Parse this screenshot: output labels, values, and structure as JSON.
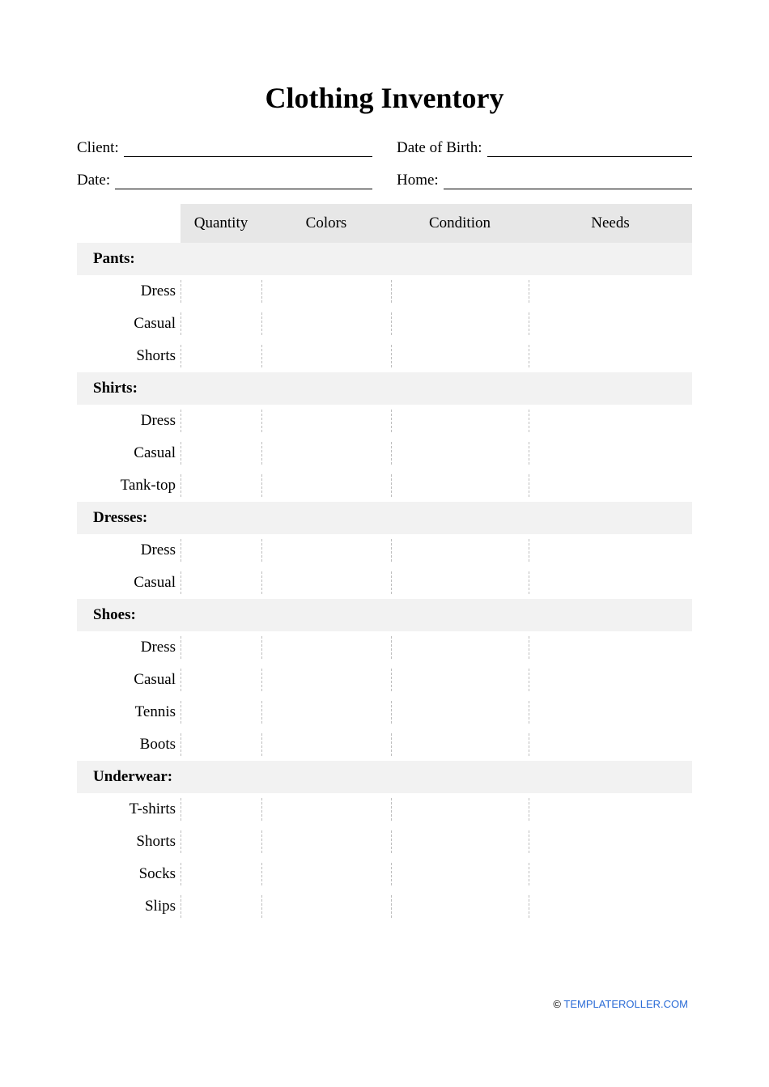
{
  "title": "Clothing Inventory",
  "fields": {
    "client_label": "Client:",
    "dob_label": "Date of Birth:",
    "date_label": "Date:",
    "home_label": "Home:",
    "client_value": "",
    "dob_value": "",
    "date_value": "",
    "home_value": ""
  },
  "columns": {
    "quantity": "Quantity",
    "colors": "Colors",
    "condition": "Condition",
    "needs": "Needs"
  },
  "sections": [
    {
      "heading": "Pants:",
      "items": [
        {
          "label": "Dress",
          "quantity": "",
          "colors": "",
          "condition": "",
          "needs": ""
        },
        {
          "label": "Casual",
          "quantity": "",
          "colors": "",
          "condition": "",
          "needs": ""
        },
        {
          "label": "Shorts",
          "quantity": "",
          "colors": "",
          "condition": "",
          "needs": ""
        }
      ]
    },
    {
      "heading": "Shirts:",
      "items": [
        {
          "label": "Dress",
          "quantity": "",
          "colors": "",
          "condition": "",
          "needs": ""
        },
        {
          "label": "Casual",
          "quantity": "",
          "colors": "",
          "condition": "",
          "needs": ""
        },
        {
          "label": "Tank-top",
          "quantity": "",
          "colors": "",
          "condition": "",
          "needs": ""
        }
      ]
    },
    {
      "heading": "Dresses:",
      "items": [
        {
          "label": "Dress",
          "quantity": "",
          "colors": "",
          "condition": "",
          "needs": ""
        },
        {
          "label": "Casual",
          "quantity": "",
          "colors": "",
          "condition": "",
          "needs": ""
        }
      ]
    },
    {
      "heading": "Shoes:",
      "items": [
        {
          "label": "Dress",
          "quantity": "",
          "colors": "",
          "condition": "",
          "needs": ""
        },
        {
          "label": "Casual",
          "quantity": "",
          "colors": "",
          "condition": "",
          "needs": ""
        },
        {
          "label": "Tennis",
          "quantity": "",
          "colors": "",
          "condition": "",
          "needs": ""
        },
        {
          "label": "Boots",
          "quantity": "",
          "colors": "",
          "condition": "",
          "needs": ""
        }
      ]
    },
    {
      "heading": "Underwear:",
      "items": [
        {
          "label": "T-shirts",
          "quantity": "",
          "colors": "",
          "condition": "",
          "needs": ""
        },
        {
          "label": "Shorts",
          "quantity": "",
          "colors": "",
          "condition": "",
          "needs": ""
        },
        {
          "label": "Socks",
          "quantity": "",
          "colors": "",
          "condition": "",
          "needs": ""
        },
        {
          "label": "Slips",
          "quantity": "",
          "colors": "",
          "condition": "",
          "needs": ""
        }
      ]
    }
  ],
  "footer": {
    "copyright": "©",
    "link_text": "TEMPLATEROLLER.COM"
  }
}
